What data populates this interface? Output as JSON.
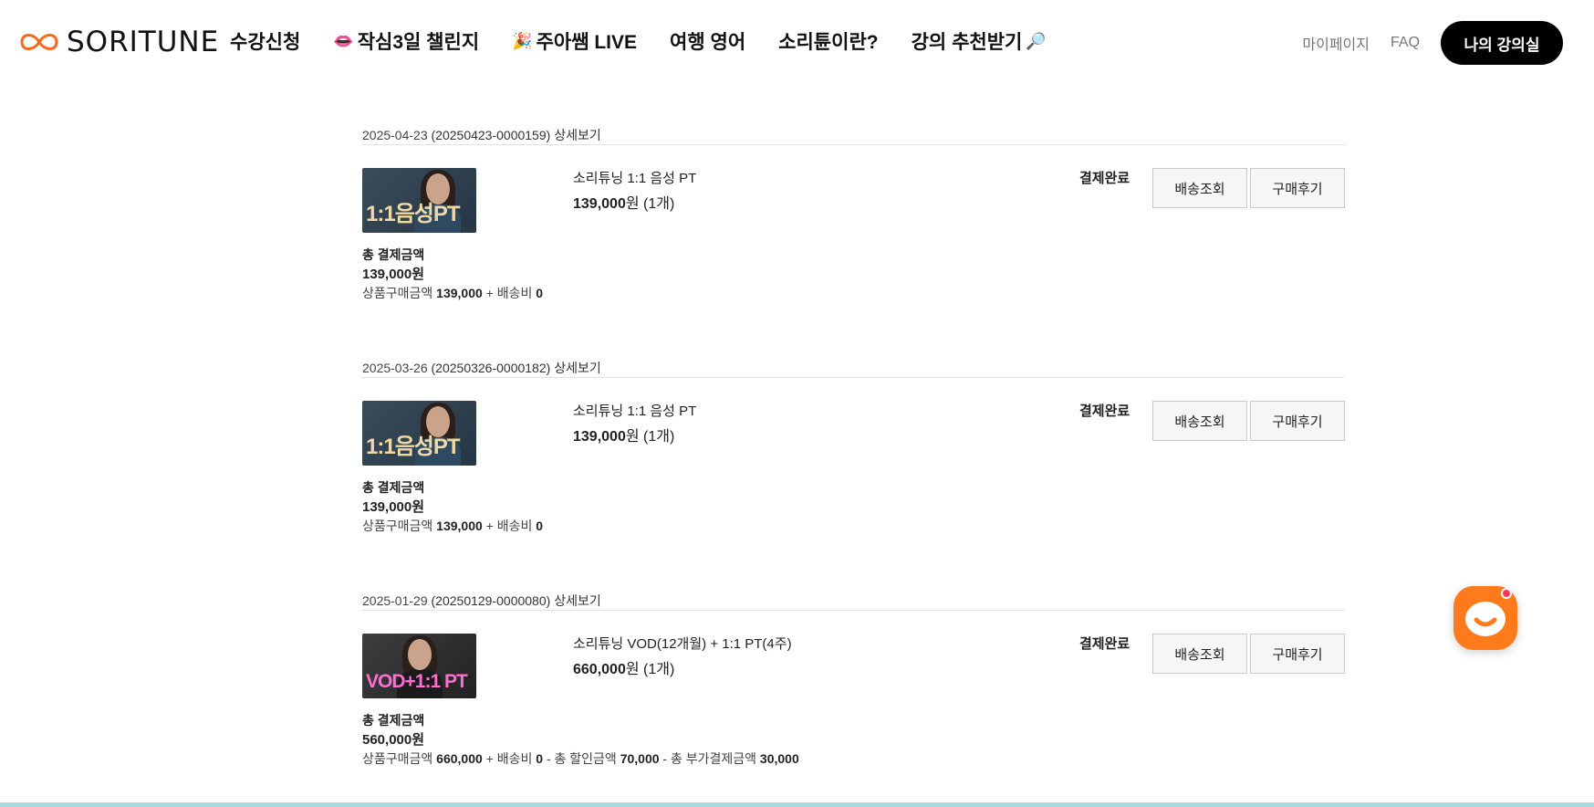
{
  "header": {
    "logo_text": "SORITUNE",
    "nav": [
      {
        "label": "수강신청",
        "emoji": ""
      },
      {
        "label": "작심3일 챌린지",
        "emoji": "👄"
      },
      {
        "label": "주아쌤 LIVE",
        "emoji": "🎉"
      },
      {
        "label": "여행 영어",
        "emoji": ""
      },
      {
        "label": "소리튠이란?",
        "emoji": ""
      },
      {
        "label": "강의 추천받기",
        "emoji": "🔎"
      }
    ],
    "mypage": "마이페이지",
    "faq": "FAQ",
    "my_class": "나의 강의실"
  },
  "labels": {
    "detail": "상세보기",
    "status": "결제완료",
    "ship": "배송조회",
    "review": "구매후기",
    "total_label": "총 결제금액",
    "goods_amount": "상품구매금액",
    "shipping_fee": "+ 배송비",
    "discount": "- 총 할인금액",
    "extra": "- 총 부가결제금액"
  },
  "orders": [
    {
      "date": "2025-04-23",
      "order_no": "(20250423-0000159)",
      "thumb_text": "1:1음성PT",
      "product": "소리튜닝 1:1 음성 PT",
      "price": "139,000",
      "unit": "원",
      "qty": "(1개)",
      "total": "139,000원",
      "goods": "139,000",
      "ship_fee": "0"
    },
    {
      "date": "2025-03-26",
      "order_no": "(20250326-0000182)",
      "thumb_text": "1:1음성PT",
      "product": "소리튜닝 1:1 음성 PT",
      "price": "139,000",
      "unit": "원",
      "qty": "(1개)",
      "total": "139,000원",
      "goods": "139,000",
      "ship_fee": "0"
    },
    {
      "date": "2025-01-29",
      "order_no": "(20250129-0000080)",
      "thumb_text": "VOD+1:1 PT",
      "product": "소리튜닝 VOD(12개월) + 1:1 PT(4주)",
      "price": "660,000",
      "unit": "원",
      "qty": "(1개)",
      "total": "560,000원",
      "goods": "660,000",
      "ship_fee": "0",
      "discount": "70,000",
      "extra": "30,000"
    }
  ],
  "colors": {
    "accent": "#ff7a1a",
    "black_button": "#000000",
    "bottom_bar": "#a7dcde"
  }
}
